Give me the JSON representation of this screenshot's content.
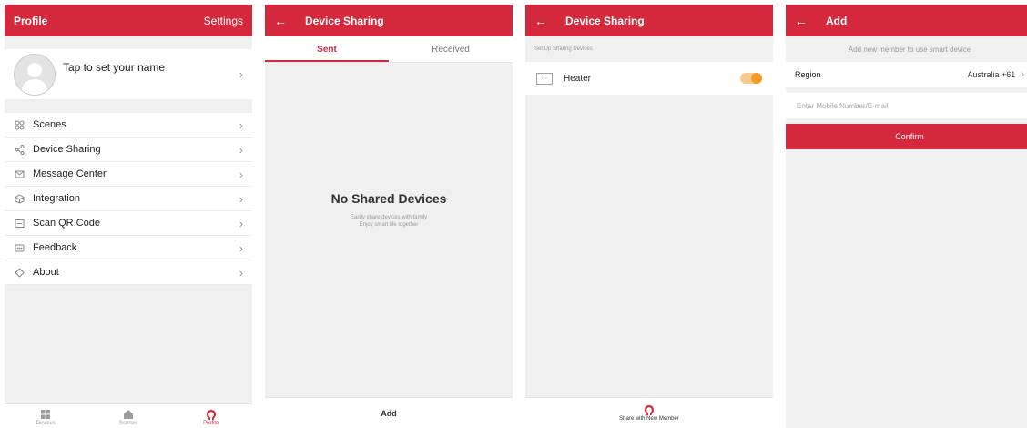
{
  "screen1": {
    "title": "Profile",
    "settings_label": "Settings",
    "profile_name": "Tap to set your name",
    "menu": [
      {
        "label": "Scenes",
        "icon": "scenes-icon"
      },
      {
        "label": "Device Sharing",
        "icon": "share-icon"
      },
      {
        "label": "Message Center",
        "icon": "message-icon"
      },
      {
        "label": "Integration",
        "icon": "integration-icon"
      },
      {
        "label": "Scan QR Code",
        "icon": "qr-code-icon"
      },
      {
        "label": "Feedback",
        "icon": "feedback-icon"
      },
      {
        "label": "About",
        "icon": "about-icon"
      }
    ],
    "nav": [
      {
        "label": "Devices",
        "icon": "devices-icon"
      },
      {
        "label": "Scenes",
        "icon": "home-icon"
      },
      {
        "label": "Profile",
        "icon": "profile-icon"
      }
    ]
  },
  "screen2": {
    "title": "Device Sharing",
    "tabs": [
      "Sent",
      "Received"
    ],
    "empty_title": "No Shared Devices",
    "empty_line1": "Easily share devices with family",
    "empty_line2": "Enjoy smart life together",
    "add_label": "Add"
  },
  "screen3": {
    "title": "Device Sharing",
    "section_label": "Set Up Sharing Devices",
    "device_name": "Heater",
    "share_label": "Share with New Member"
  },
  "screen4": {
    "title": "Add",
    "helper": "Add new member to use smart device",
    "region_label": "Region",
    "region_value": "Australia +61",
    "input_placeholder": "Enter Mobile Number/E-mail",
    "confirm_label": "Confirm"
  },
  "colors": {
    "accent": "#d4283d",
    "toggle": "#f69a26",
    "background": "#f0f0f0"
  }
}
